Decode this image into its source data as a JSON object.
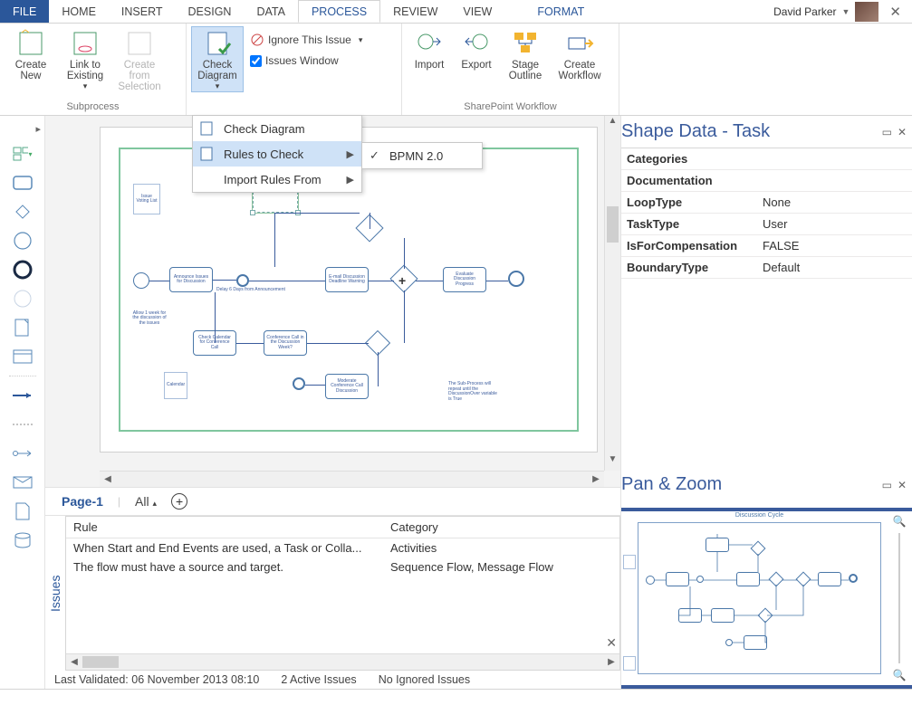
{
  "tabs": {
    "file": "FILE",
    "home": "HOME",
    "insert": "INSERT",
    "design": "DESIGN",
    "data": "DATA",
    "process": "PROCESS",
    "review": "REVIEW",
    "view": "VIEW",
    "format": "FORMAT"
  },
  "user": {
    "name": "David Parker"
  },
  "ribbon": {
    "subprocess": {
      "label": "Subprocess",
      "create_new": "Create\nNew",
      "link_existing": "Link to\nExisting",
      "create_selection": "Create from\nSelection"
    },
    "diagram_validation": {
      "check_diagram": "Check\nDiagram",
      "ignore_this_issue": "Ignore This Issue",
      "issues_window": "Issues Window"
    },
    "sharepoint": {
      "label": "SharePoint Workflow",
      "import": "Import",
      "export": "Export",
      "stage_outline": "Stage\nOutline",
      "create_workflow": "Create\nWorkflow"
    }
  },
  "menu": {
    "check_diagram": "Check Diagram",
    "rules_to_check": "Rules to Check",
    "import_rules": "Import Rules From",
    "bpmn": "BPMN 2.0"
  },
  "pages": {
    "page1": "Page-1",
    "all": "All"
  },
  "shape_data": {
    "title": "Shape Data - Task",
    "rows": [
      {
        "k": "Categories",
        "v": ""
      },
      {
        "k": "Documentation",
        "v": ""
      },
      {
        "k": "LoopType",
        "v": "None"
      },
      {
        "k": "TaskType",
        "v": "User"
      },
      {
        "k": "IsForCompensation",
        "v": "FALSE"
      },
      {
        "k": "BoundaryType",
        "v": "Default"
      }
    ]
  },
  "pan_zoom": {
    "title": "Pan & Zoom",
    "mini_title": "Discussion Cycle"
  },
  "issues": {
    "label": "Issues",
    "headers": {
      "rule": "Rule",
      "category": "Category"
    },
    "rows": [
      {
        "rule": "When Start and End Events are used, a Task or Colla...",
        "category": "Activities"
      },
      {
        "rule": "The flow must have a source and target.",
        "category": "Sequence Flow, Message Flow"
      }
    ],
    "status": {
      "validated": "Last Validated: 06 November 2013 08:10",
      "active": "2 Active Issues",
      "ignored": "No Ignored Issues"
    }
  },
  "diagram": {
    "notes": {
      "voting": "Issue Voting List",
      "allow": "Allow 1 week for the discussion of the issues",
      "calendar": "Calendar",
      "repeat": "The Sub-Process will repeat until the DiscussionOver variable is True"
    },
    "tasks": {
      "announce": "Announce Issues for Discussion",
      "delay": "Delay 6 Days from Announcement",
      "email": "E-mail Discussion Deadline Warning",
      "evaluate": "Evaluate Discussion Progress",
      "checkcal": "Check Calendar for Conference Call",
      "confcall": "Conference Call in the Discussion Week?",
      "moderate": "Moderate Conference Call Discussion"
    }
  }
}
